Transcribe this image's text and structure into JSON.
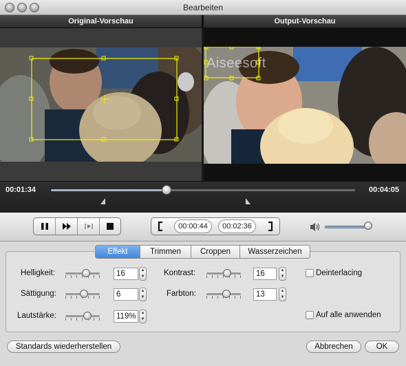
{
  "window": {
    "title": "Bearbeiten"
  },
  "preview": {
    "original_label": "Original-Vorschau",
    "output_label": "Output-Vorschau",
    "watermark_text": "Aiseesoft"
  },
  "timeline": {
    "start_time": "00:01:34",
    "end_time": "00:04:05",
    "position_fraction": 0.38
  },
  "controls": {
    "trim_start": "00:00:44",
    "trim_end": "00:02:36",
    "volume_fraction": 0.87
  },
  "tabs": [
    "Effekt",
    "Trimmen",
    "Croppen",
    "Wasserzeichen"
  ],
  "active_tab": "Effekt",
  "effects": {
    "brightness_label": "Helligkeit:",
    "brightness_value": "16",
    "saturation_label": "Sättigung:",
    "saturation_value": "6",
    "volume_label": "Lautstärke:",
    "volume_value": "119%",
    "contrast_label": "Kontrast:",
    "contrast_value": "16",
    "hue_label": "Farbton:",
    "hue_value": "13",
    "deinterlacing_label": "Deinterlacing",
    "apply_all_label": "Auf alle anwenden"
  },
  "buttons": {
    "reset": "Standards wiederherstellen",
    "cancel": "Abbrechen",
    "ok": "OK"
  },
  "icons": [
    "pause-icon",
    "fast-forward-icon",
    "snapshot-icon",
    "stop-icon",
    "trim-start-icon",
    "trim-end-icon",
    "speaker-icon"
  ]
}
